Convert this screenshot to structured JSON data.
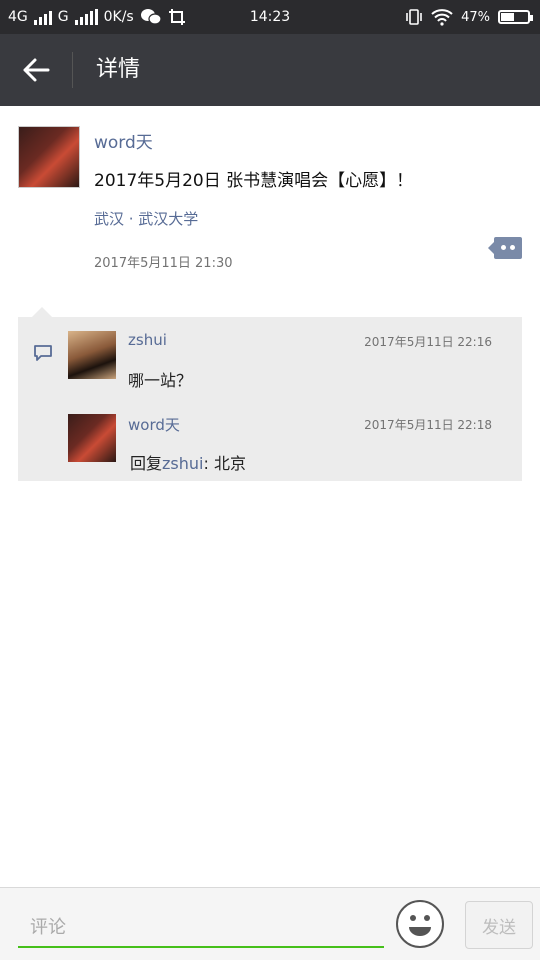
{
  "status_bar": {
    "network_1": "4G",
    "network_2": "G",
    "speed": "0K/s",
    "time": "14:23",
    "battery": "47%",
    "battery_level": 0.47
  },
  "app_bar": {
    "title": "详情"
  },
  "post": {
    "author": "word天",
    "text": "2017年5月20日 张书慧演唱会【心愿】！",
    "location": "武汉 · 武汉大学",
    "time": "2017年5月11日 21:30"
  },
  "comments": [
    {
      "author": "zshui",
      "time": "2017年5月11日 22:16",
      "text": "哪一站？"
    },
    {
      "author": "word天",
      "time": "2017年5月11日 22:18",
      "reply_prefix": "回复",
      "reply_to": "zshui",
      "reply_text": ": 北京"
    }
  ],
  "composer": {
    "placeholder": "评论",
    "send_label": "发送"
  },
  "colors": {
    "link": "#576b95",
    "app_bar": "#393a3f",
    "accent": "#45c01a"
  }
}
